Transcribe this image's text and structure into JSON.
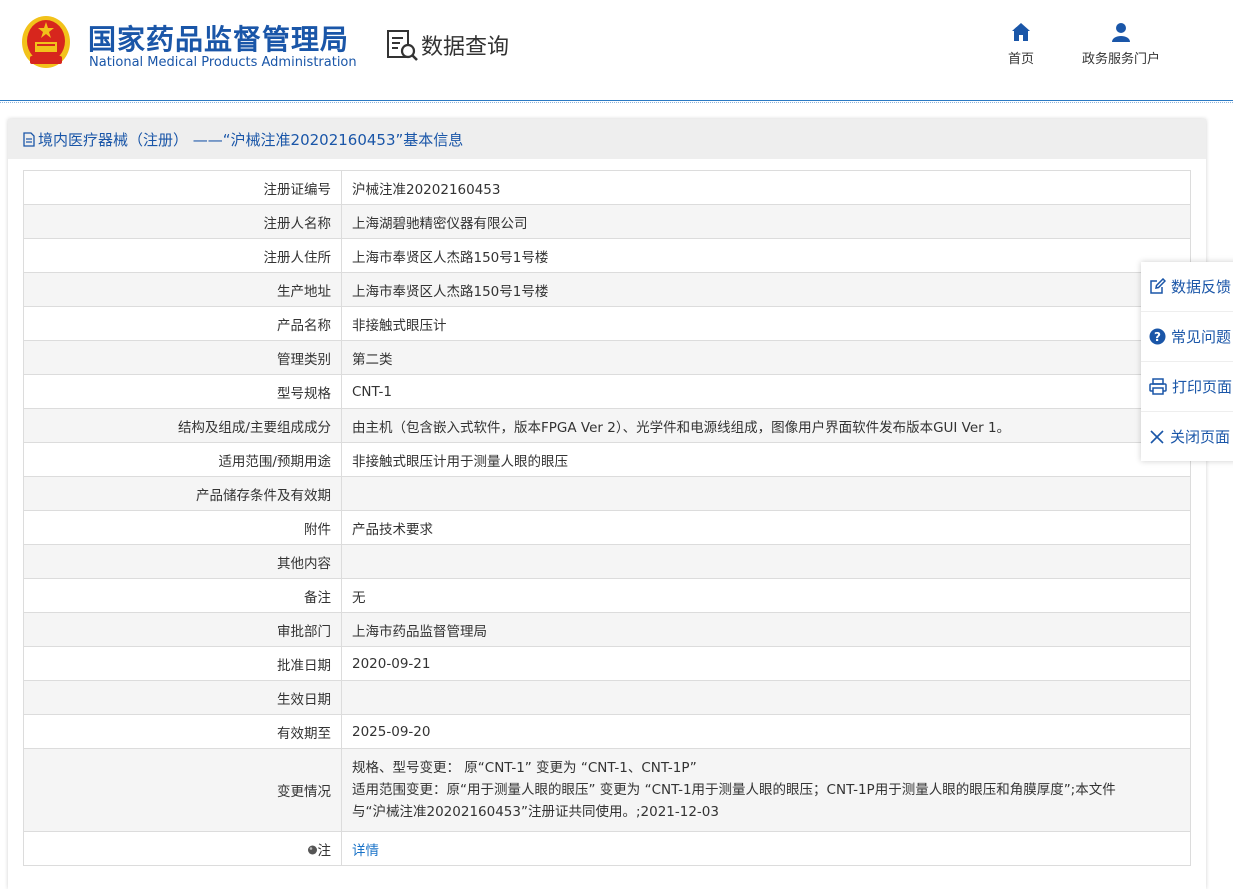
{
  "header": {
    "title_cn": "国家药品监督管理局",
    "title_en": "National Medical Products Administration",
    "query_label": "数据查询",
    "nav": [
      {
        "label": "首页",
        "icon": "home-icon"
      },
      {
        "label": "政务服务门户",
        "icon": "user-icon"
      }
    ]
  },
  "panel": {
    "title": "境内医疗器械（注册） ——“沪械注准20202160453”基本信息"
  },
  "rows": [
    {
      "key": "注册证编号",
      "value": "沪械注准20202160453"
    },
    {
      "key": "注册人名称",
      "value": "上海湖碧驰精密仪器有限公司"
    },
    {
      "key": "注册人住所",
      "value": "上海市奉贤区人杰路150号1号楼"
    },
    {
      "key": "生产地址",
      "value": "上海市奉贤区人杰路150号1号楼"
    },
    {
      "key": "产品名称",
      "value": "非接触式眼压计"
    },
    {
      "key": "管理类别",
      "value": "第二类"
    },
    {
      "key": "型号规格",
      "value": "CNT-1"
    },
    {
      "key": "结构及组成/主要组成成分",
      "value": "由主机（包含嵌入式软件，版本FPGA Ver 2）、光学件和电源线组成，图像用户界面软件发布版本GUI Ver 1。"
    },
    {
      "key": "适用范围/预期用途",
      "value": "非接触式眼压计用于测量人眼的眼压"
    },
    {
      "key": "产品储存条件及有效期",
      "value": ""
    },
    {
      "key": "附件",
      "value": "产品技术要求"
    },
    {
      "key": "其他内容",
      "value": ""
    },
    {
      "key": "备注",
      "value": "无"
    },
    {
      "key": "审批部门",
      "value": "上海市药品监督管理局"
    },
    {
      "key": "批准日期",
      "value": "2020-09-21"
    },
    {
      "key": "生效日期",
      "value": ""
    },
    {
      "key": "有效期至",
      "value": "2025-09-20"
    }
  ],
  "change": {
    "key": "变更情况",
    "line1": "规格、型号变更： 原“CNT-1” 变更为 “CNT-1、CNT-1P”",
    "line2": "适用范围变更：原“用于测量人眼的眼压” 变更为 “CNT-1用于测量人眼的眼压；CNT-1P用于测量人眼的眼压和角膜厚度”;本文件",
    "line3": "与“沪械注准20202160453”注册证共同使用。;2021-12-03"
  },
  "note": {
    "key": "注",
    "link": "详情"
  },
  "sidebar": [
    {
      "label": "数据反馈",
      "icon": "edit-icon"
    },
    {
      "label": "常见问题",
      "icon": "question-icon"
    },
    {
      "label": "打印页面",
      "icon": "print-icon"
    },
    {
      "label": "关闭页面",
      "icon": "close-icon"
    }
  ],
  "colors": {
    "brand_blue": "#1a56a8",
    "emblem_red": "#d7261d",
    "emblem_gold": "#f2c21a"
  }
}
